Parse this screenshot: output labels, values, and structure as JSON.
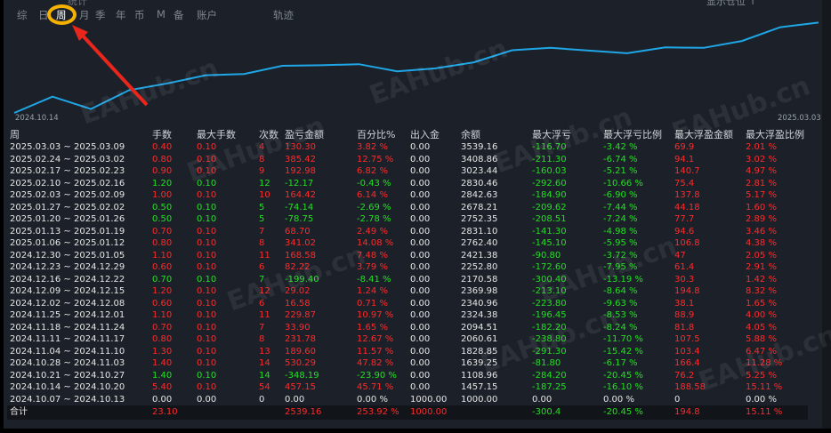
{
  "tabs": [
    {
      "label": "综",
      "active": false
    },
    {
      "label": "日",
      "active": false
    },
    {
      "label": "周",
      "active": true
    },
    {
      "label": "月",
      "active": false
    },
    {
      "label": "季",
      "active": false
    },
    {
      "label": "年",
      "active": false
    },
    {
      "label": "币",
      "active": false
    },
    {
      "label": "M",
      "active": false
    },
    {
      "label": "备",
      "active": false
    },
    {
      "label": "账户",
      "active": false
    },
    {
      "label": "轨迹",
      "active": false
    }
  ],
  "header_fragment": "统计",
  "header_right_fragment": "显示仓位 ↑",
  "chart": {
    "start_label": "2024.10.14",
    "end_label": "2025.03.03",
    "line_color": "#1fa6e6",
    "balance": [
      1000.0,
      1457.15,
      1108.96,
      1639.25,
      1828.85,
      2060.61,
      2094.51,
      2324.38,
      2340.96,
      2369.98,
      2170.58,
      2252.8,
      2421.38,
      2762.4,
      2831.1,
      2752.35,
      2678.21,
      2842.63,
      2830.46,
      3023.44,
      3408.86,
      3539.16
    ]
  },
  "watermark": "EAHub.cn",
  "table": {
    "headers": [
      "周",
      "手数",
      "最大手数",
      "次数",
      "盈亏金额",
      "百分比%",
      "出入金",
      "余额",
      "最大浮亏",
      "最大浮亏比例",
      "最大浮盈金额",
      "最大浮盈比例"
    ],
    "rows": [
      [
        "2025.03.03 ~ 2025.03.09",
        "0.40",
        "0.10",
        "4",
        "130.30",
        "3.82 %",
        "0.00",
        "3539.16",
        "-116.70",
        "-3.42 %",
        "69.9",
        "2.01 %"
      ],
      [
        "2025.02.24 ~ 2025.03.02",
        "0.80",
        "0.10",
        "8",
        "385.42",
        "12.75 %",
        "0.00",
        "3408.86",
        "-211.30",
        "-6.74 %",
        "94.1",
        "3.02 %"
      ],
      [
        "2025.02.17 ~ 2025.02.23",
        "0.90",
        "0.10",
        "9",
        "192.98",
        "6.82 %",
        "0.00",
        "3023.44",
        "-160.03",
        "-5.21 %",
        "140.7",
        "4.97 %"
      ],
      [
        "2025.02.10 ~ 2025.02.16",
        "1.20",
        "0.10",
        "12",
        "-12.17",
        "-0.43 %",
        "0.00",
        "2830.46",
        "-292.60",
        "-10.66 %",
        "75.4",
        "2.81 %"
      ],
      [
        "2025.02.03 ~ 2025.02.09",
        "1.00",
        "0.10",
        "10",
        "164.42",
        "6.14 %",
        "0.00",
        "2842.63",
        "-184.90",
        "-6.90 %",
        "137.8",
        "5.17 %"
      ],
      [
        "2025.01.27 ~ 2025.02.02",
        "0.50",
        "0.10",
        "5",
        "-74.14",
        "-2.69 %",
        "0.00",
        "2678.21",
        "-209.62",
        "-7.44 %",
        "44.18",
        "1.60 %"
      ],
      [
        "2025.01.20 ~ 2025.01.26",
        "0.50",
        "0.10",
        "5",
        "-78.75",
        "-2.78 %",
        "0.00",
        "2752.35",
        "-208.51",
        "-7.24 %",
        "77.7",
        "2.89 %"
      ],
      [
        "2025.01.13 ~ 2025.01.19",
        "0.70",
        "0.10",
        "7",
        "68.70",
        "2.49 %",
        "0.00",
        "2831.10",
        "-141.30",
        "-4.98 %",
        "94.6",
        "3.46 %"
      ],
      [
        "2025.01.06 ~ 2025.01.12",
        "0.80",
        "0.10",
        "8",
        "341.02",
        "14.08 %",
        "0.00",
        "2762.40",
        "-145.10",
        "-5.95 %",
        "106.8",
        "4.38 %"
      ],
      [
        "2024.12.30 ~ 2025.01.05",
        "1.10",
        "0.10",
        "11",
        "168.58",
        "7.48 %",
        "0.00",
        "2421.38",
        "-90.80",
        "-3.72 %",
        "47",
        "2.05 %"
      ],
      [
        "2024.12.23 ~ 2024.12.29",
        "0.60",
        "0.10",
        "6",
        "82.22",
        "3.79 %",
        "0.00",
        "2252.80",
        "-172.60",
        "-7.95 %",
        "61.4",
        "2.91 %"
      ],
      [
        "2024.12.16 ~ 2024.12.22",
        "0.70",
        "0.10",
        "7",
        "-199.40",
        "-8.41 %",
        "0.00",
        "2170.58",
        "-300.40",
        "-13.19 %",
        "30.3",
        "1.42 %"
      ],
      [
        "2024.12.09 ~ 2024.12.15",
        "1.20",
        "0.10",
        "12",
        "29.02",
        "1.24 %",
        "0.00",
        "2369.98",
        "-213.10",
        "-8.64 %",
        "194.8",
        "8.32 %"
      ],
      [
        "2024.12.02 ~ 2024.12.08",
        "0.60",
        "0.10",
        "6",
        "16.58",
        "0.71 %",
        "0.00",
        "2340.96",
        "-223.80",
        "-9.63 %",
        "38.1",
        "1.65 %"
      ],
      [
        "2024.11.25 ~ 2024.12.01",
        "1.10",
        "0.10",
        "11",
        "229.87",
        "10.97 %",
        "0.00",
        "2324.38",
        "-196.45",
        "-8.53 %",
        "88.9",
        "4.00 %"
      ],
      [
        "2024.11.18 ~ 2024.11.24",
        "0.70",
        "0.10",
        "7",
        "33.90",
        "1.65 %",
        "0.00",
        "2094.51",
        "-182.20",
        "-8.24 %",
        "81.8",
        "4.05 %"
      ],
      [
        "2024.11.11 ~ 2024.11.17",
        "0.80",
        "0.10",
        "8",
        "231.78",
        "12.67 %",
        "0.00",
        "2060.61",
        "-238.80",
        "-11.70 %",
        "107.5",
        "5.88 %"
      ],
      [
        "2024.11.04 ~ 2024.11.10",
        "1.30",
        "0.10",
        "13",
        "189.60",
        "11.57 %",
        "0.00",
        "1828.85",
        "-291.30",
        "-15.42 %",
        "103.4",
        "6.47 %"
      ],
      [
        "2024.10.28 ~ 2024.11.03",
        "1.40",
        "0.10",
        "14",
        "530.29",
        "47.82 %",
        "0.00",
        "1639.25",
        "-81.80",
        "-6.17 %",
        "166.4",
        "11.28 %"
      ],
      [
        "2024.10.21 ~ 2024.10.27",
        "1.40",
        "0.10",
        "14",
        "-348.19",
        "-23.90 %",
        "0.00",
        "1108.96",
        "-284.20",
        "-20.45 %",
        "76.2",
        "5.25 %"
      ],
      [
        "2024.10.14 ~ 2024.10.20",
        "5.40",
        "0.10",
        "54",
        "457.15",
        "45.71 %",
        "0.00",
        "1457.15",
        "-187.25",
        "-16.10 %",
        "188.58",
        "15.11 %"
      ],
      [
        "2024.10.07 ~ 2024.10.13",
        "0.00",
        "0.00",
        "0",
        "0.00",
        "0.00 %",
        "1000.00",
        "1000.00",
        "0.00",
        "0.00 %",
        "0",
        "0.00 %"
      ]
    ],
    "total": [
      "合计",
      "23.10",
      "",
      "",
      "2539.16",
      "253.92 %",
      "1000.00",
      "",
      "-300.4",
      "-20.45 %",
      "194.8",
      "15.11 %"
    ]
  },
  "colors": {
    "positive": "#ff2a2a",
    "negative": "#22e022",
    "neutral": "#e6e6e6",
    "highlight_ring": "#f5b100",
    "arrow": "#e8261c",
    "background": "#1c2129"
  }
}
